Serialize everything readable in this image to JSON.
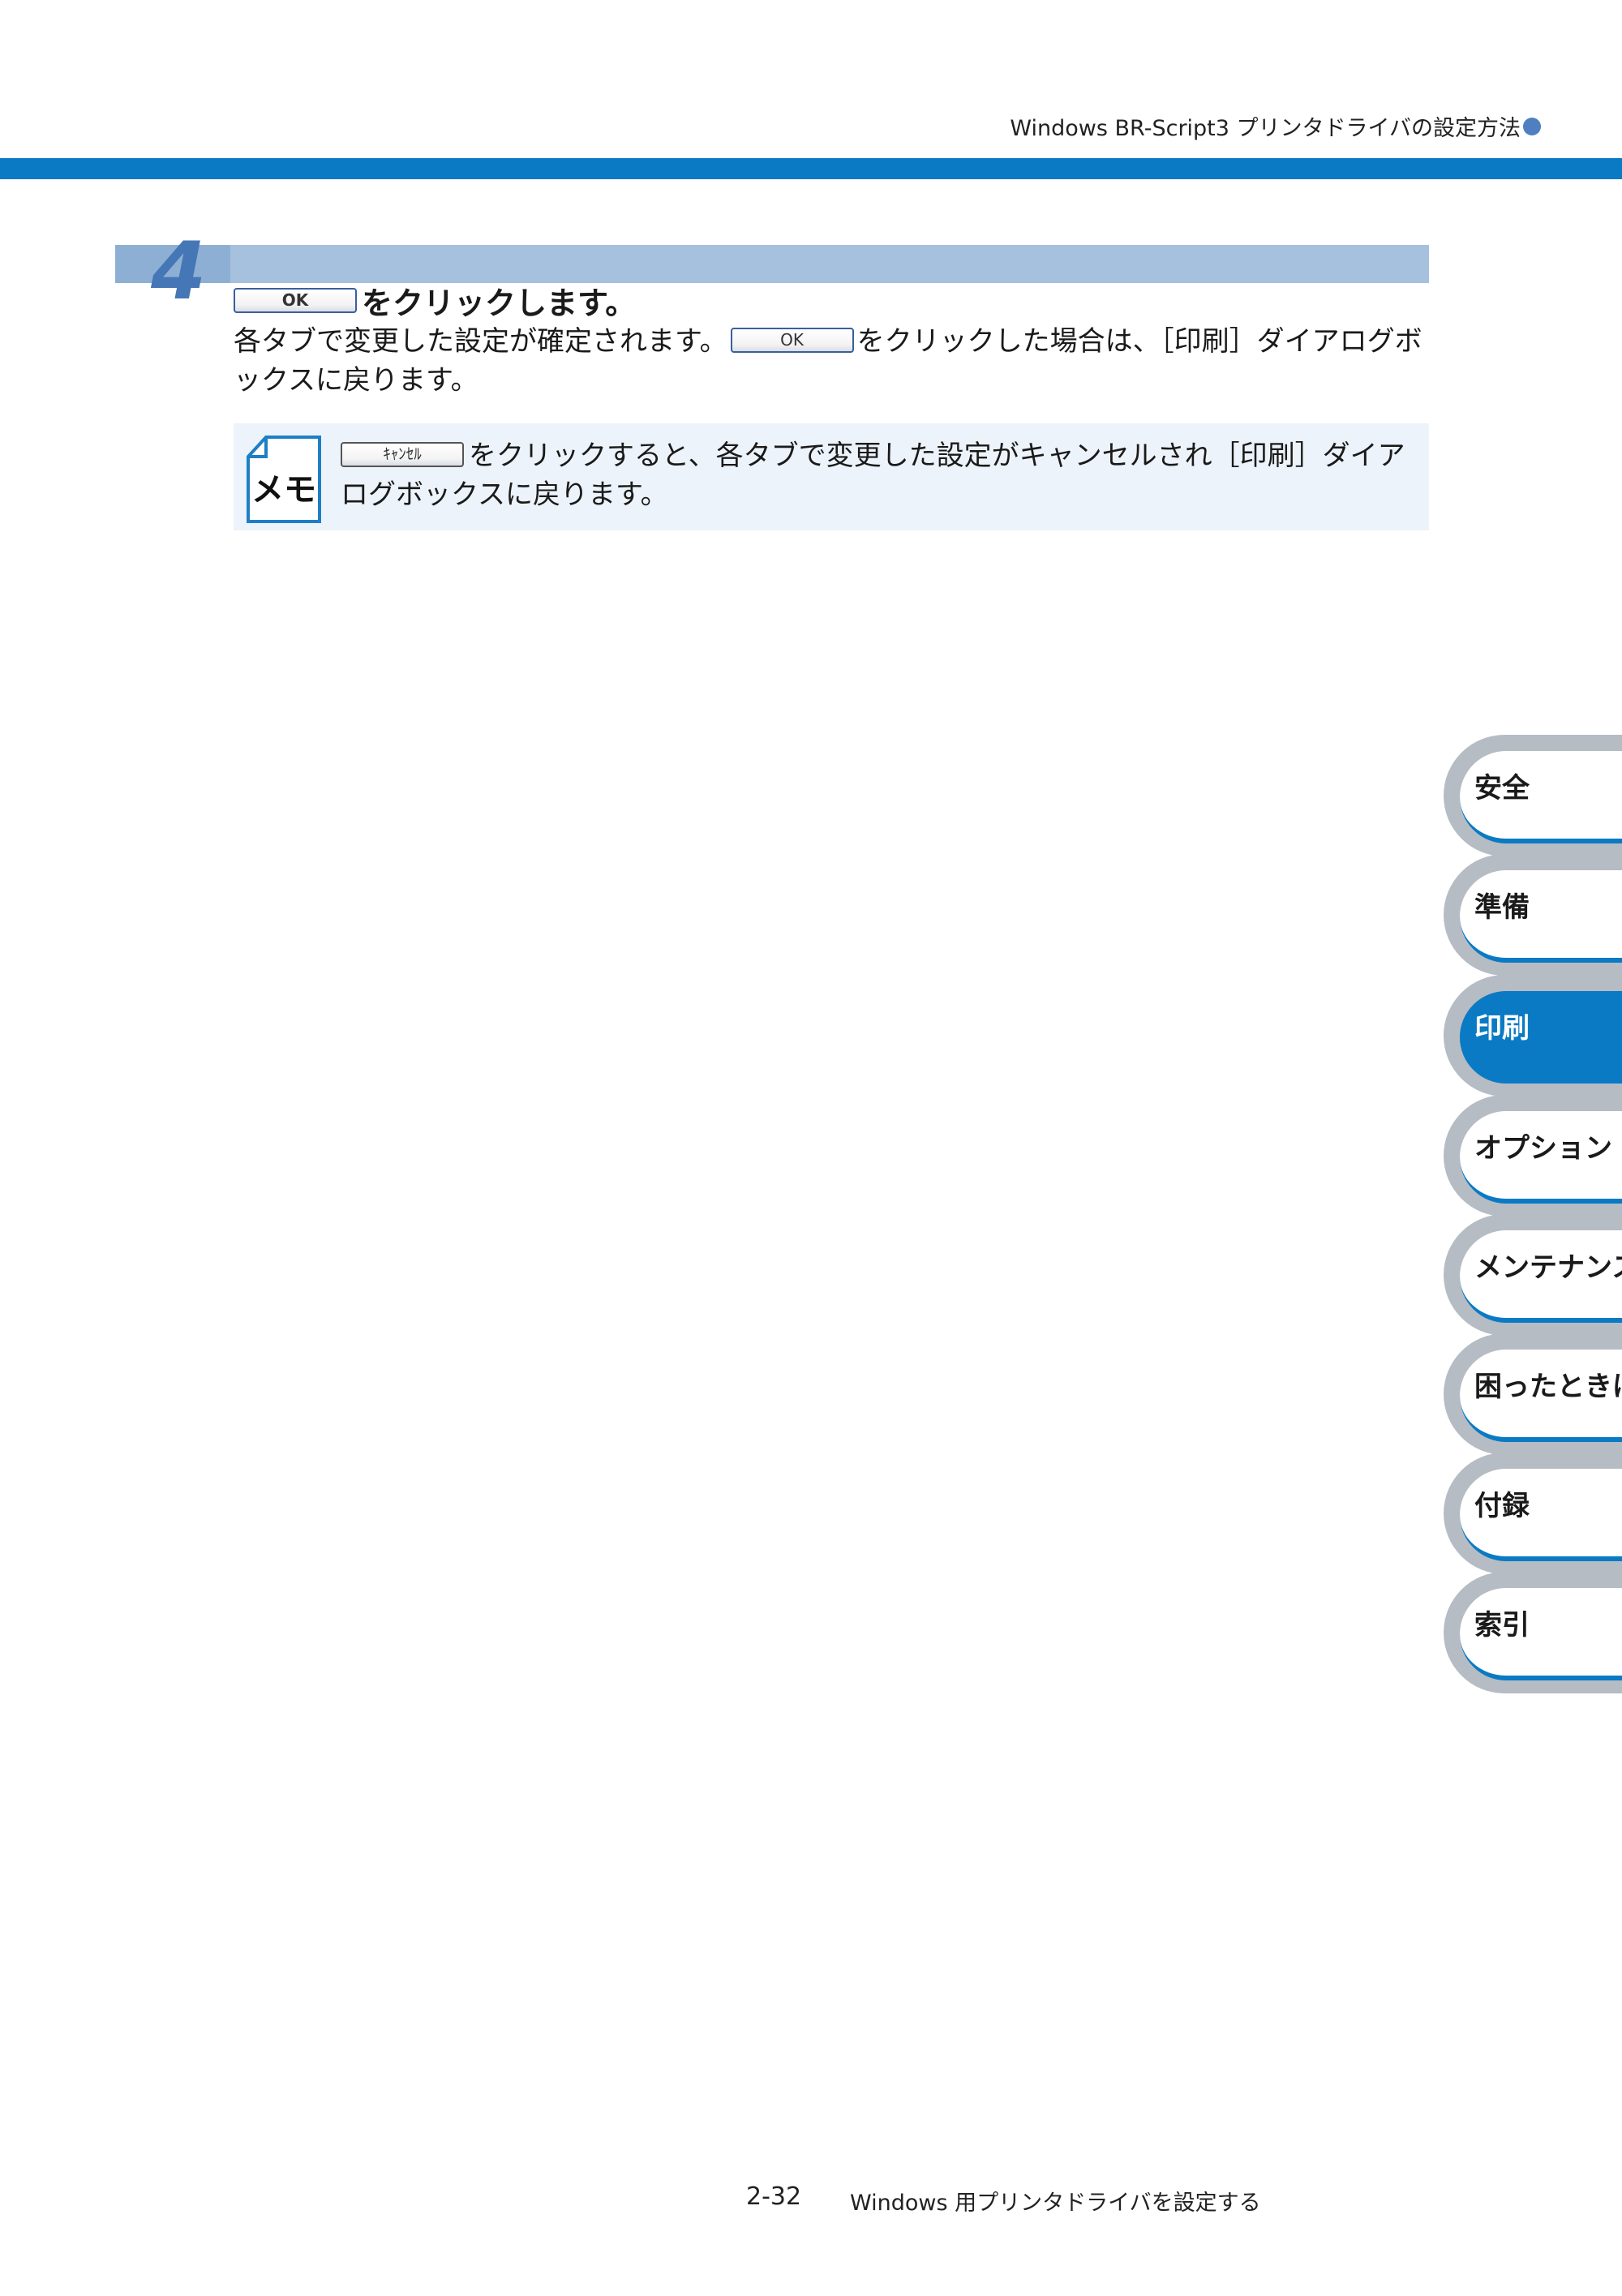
{
  "header": {
    "title": "Windows BR-Script3 プリンタドライバの設定方法"
  },
  "step": {
    "number": "4",
    "ok_button_label": "OK",
    "title": "をクリックします。",
    "body_part1": "各タブで変更した設定が確定されます。",
    "body_part2": "をクリックした場合は、［印刷］ダイアログボックスに戻ります。"
  },
  "memo": {
    "icon_label": "メモ",
    "cancel_button_label": "ｷｬﾝｾﾙ",
    "text": "をクリックすると、各タブで変更した設定がキャンセルされ［印刷］ダイアログボックスに戻ります。"
  },
  "side_tabs": [
    {
      "label": "安全"
    },
    {
      "label": "準備"
    },
    {
      "label": "印刷"
    },
    {
      "label": "オプション"
    },
    {
      "label": "メンテナンス"
    },
    {
      "label": "困ったときは"
    },
    {
      "label": "付録"
    },
    {
      "label": "索引"
    }
  ],
  "active_tab_index": 2,
  "footer": {
    "page_number": "2-32",
    "title": "Windows 用プリンタドライバを設定する"
  },
  "colors": {
    "accent": "#0a7ac4",
    "band": "#a6c1de",
    "memo_bg": "#edf3fa",
    "tab_gray": "#b6bcc4"
  }
}
